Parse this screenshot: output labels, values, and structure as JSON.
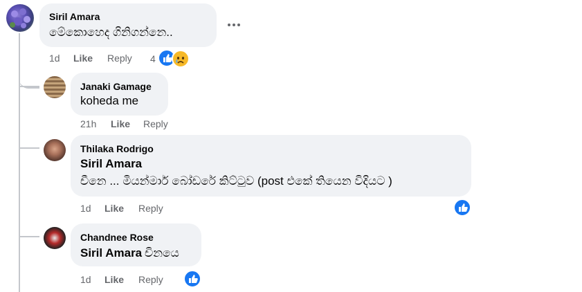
{
  "comments": [
    {
      "author": "Siril Amara",
      "text": "මේකොහෙද ගිනිගන්නෙ..",
      "time": "1d",
      "like_label": "Like",
      "reply_label": "Reply",
      "reaction_count": "4",
      "reactions": [
        "like-icon",
        "sad-icon"
      ]
    }
  ],
  "replies": [
    {
      "author": "Janaki Gamage",
      "text": "koheda me",
      "time": "21h",
      "like_label": "Like",
      "reply_label": "Reply"
    },
    {
      "author": "Thilaka Rodrigo",
      "mention": "Siril Amara",
      "text": "චීනෙ ... මියන්මාර් බෝඩරේ කිට්ටුව (post එකේ තියෙන විදියට )",
      "time": "1d",
      "like_label": "Like",
      "reply_label": "Reply",
      "reactions": [
        "like-icon"
      ]
    },
    {
      "author": "Chandnee Rose",
      "mention": "Siril Amara",
      "text": "චිනයෙ",
      "time": "1d",
      "like_label": "Like",
      "reply_label": "Reply",
      "reactions": [
        "like-icon"
      ]
    }
  ],
  "more_options_icon": "more-horizontal-icon",
  "colors": {
    "bubble": "#f0f2f5",
    "like_blue": "#1877f2",
    "meta": "#65676b",
    "thread_line": "#c4c7cc"
  }
}
